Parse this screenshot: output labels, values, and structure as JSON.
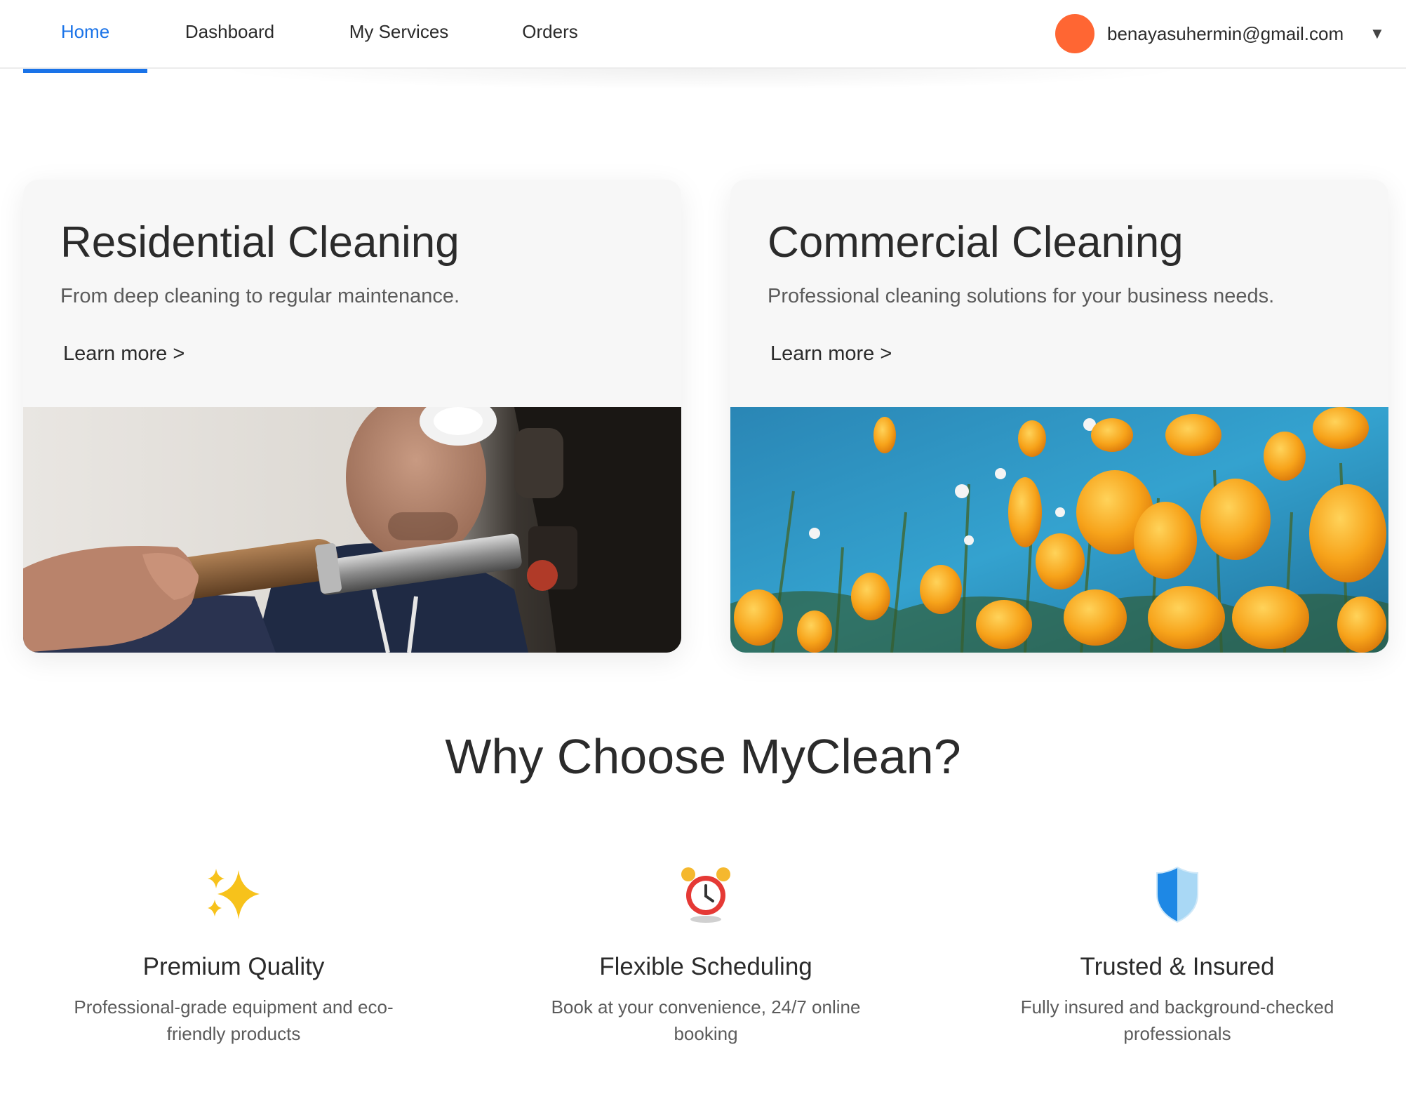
{
  "nav": {
    "tabs": [
      {
        "label": "Home",
        "active": true
      },
      {
        "label": "Dashboard",
        "active": false
      },
      {
        "label": "My Services",
        "active": false
      },
      {
        "label": "Orders",
        "active": false
      }
    ],
    "user": {
      "email": "benayasuhermin@gmail.com",
      "avatar_color": "#ff6633",
      "caret": "▼"
    },
    "accent_color": "#1a73e8"
  },
  "cards": [
    {
      "title": "Residential Cleaning",
      "description": "From deep cleaning to regular maintenance.",
      "link": "Learn more >",
      "image": "man-holding-tool-photo"
    },
    {
      "title": "Commercial Cleaning",
      "description": "Professional cleaning solutions for your business needs.",
      "link": "Learn more >",
      "image": "orange-poppies-blue-sky-photo"
    }
  ],
  "why": {
    "title": "Why Choose MyClean?",
    "features": [
      {
        "icon": "sparkles-icon",
        "title": "Premium Quality",
        "description": "Professional-grade equipment and eco-friendly products"
      },
      {
        "icon": "alarm-clock-icon",
        "title": "Flexible Scheduling",
        "description": "Book at your convenience, 24/7 online booking"
      },
      {
        "icon": "shield-icon",
        "title": "Trusted & Insured",
        "description": "Fully insured and background-checked professionals"
      }
    ]
  }
}
